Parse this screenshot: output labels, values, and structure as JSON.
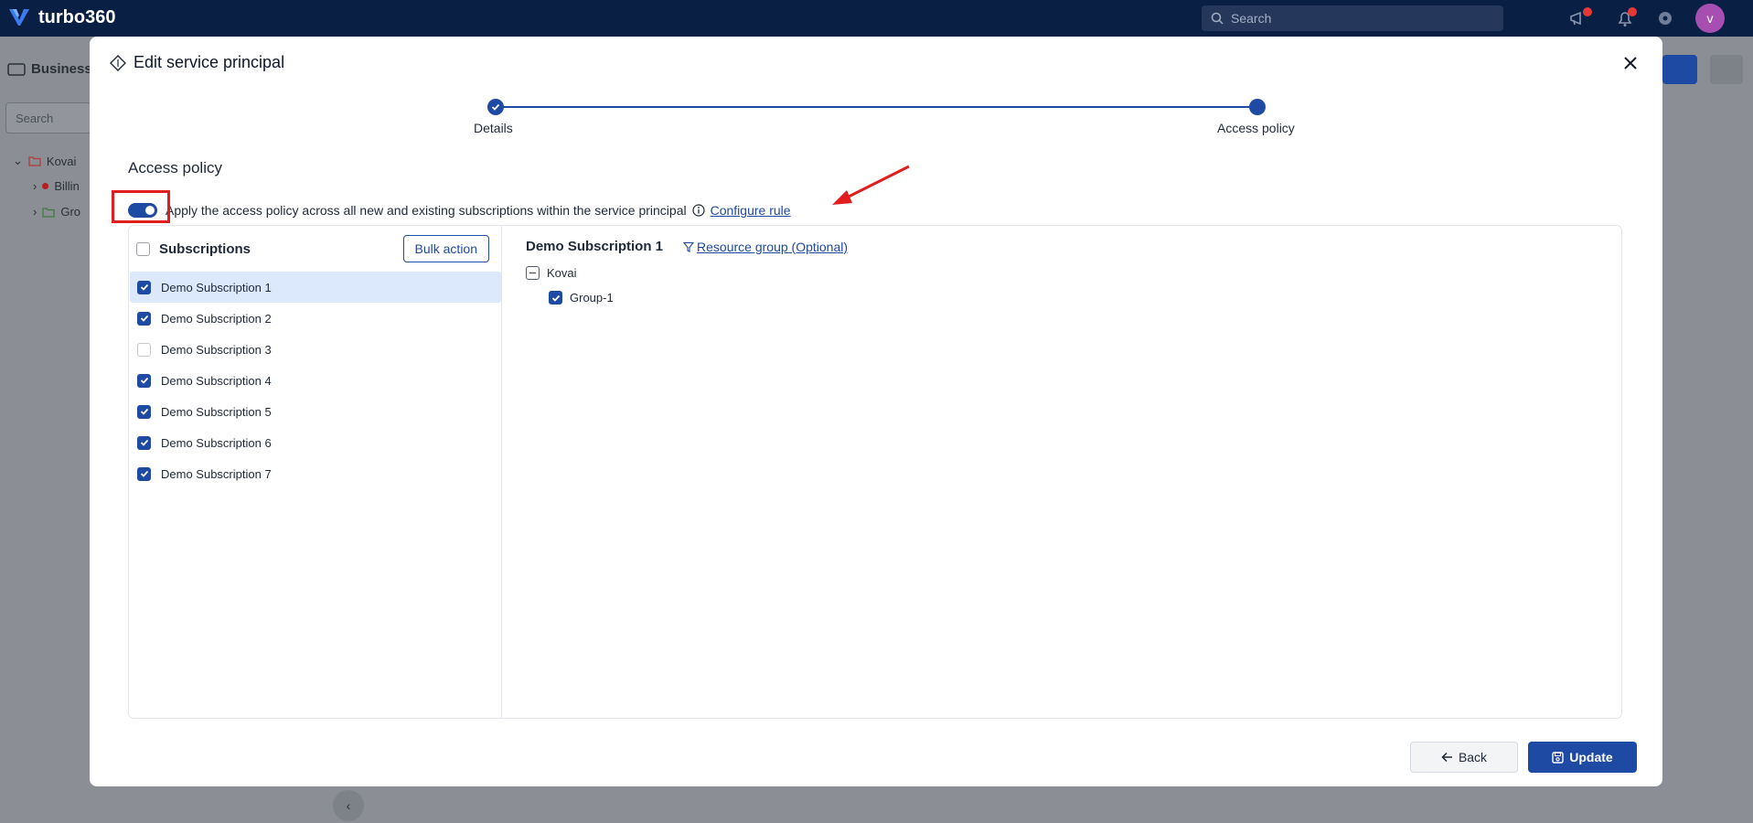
{
  "app": {
    "name": "turbo360",
    "avatar_initial": "v"
  },
  "topbar": {
    "search_placeholder": "Search"
  },
  "background": {
    "page_title": "Business",
    "search_placeholder": "Search",
    "tree": [
      "Kovai",
      "Billin",
      "Gro"
    ]
  },
  "modal": {
    "title": "Edit service principal",
    "steps": [
      {
        "label": "Details",
        "state": "completed"
      },
      {
        "label": "Access policy",
        "state": "current"
      }
    ],
    "section_title": "Access policy",
    "toggle": {
      "on": true,
      "text": "Apply the access policy across all new and existing subscriptions within the service principal",
      "link": "Configure rule"
    },
    "subscriptions": {
      "header": "Subscriptions",
      "bulk_action": "Bulk action",
      "items": [
        {
          "label": "Demo Subscription 1",
          "checked": true,
          "selected": true
        },
        {
          "label": "Demo Subscription 2",
          "checked": true,
          "selected": false
        },
        {
          "label": "Demo Subscription 3",
          "checked": false,
          "selected": false
        },
        {
          "label": "Demo Subscription 4",
          "checked": true,
          "selected": false
        },
        {
          "label": "Demo Subscription 5",
          "checked": true,
          "selected": false
        },
        {
          "label": "Demo Subscription 6",
          "checked": true,
          "selected": false
        },
        {
          "label": "Demo Subscription 7",
          "checked": true,
          "selected": false
        }
      ]
    },
    "detail": {
      "title": "Demo Subscription 1",
      "filter_link": "Resource group (Optional)",
      "tree": [
        {
          "label": "Kovai",
          "state": "partial"
        },
        {
          "label": "Group-1",
          "state": "checked"
        }
      ]
    },
    "footer": {
      "back": "Back",
      "update": "Update"
    }
  },
  "colors": {
    "primary": "#1f4aa3",
    "topbar": "#0a1f44",
    "annotation": "#e01e1e",
    "selected_row": "#dce8fb"
  }
}
